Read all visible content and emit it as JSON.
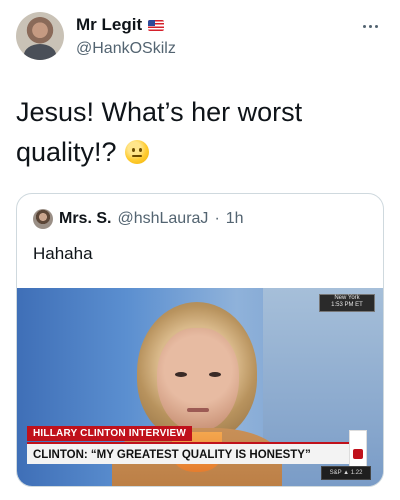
{
  "author": {
    "display_name": "Mr Legit",
    "handle": "@HankOSkilz",
    "flag_icon": "us-flag-icon"
  },
  "tweet": {
    "text": "Jesus! What’s her worst quality!?",
    "emoji_icon": "neutral-face-emoji-icon"
  },
  "quoted_tweet": {
    "display_name": "Mrs. S.",
    "handle": "@hshLauraJ",
    "separator": "·",
    "time": "1h",
    "text": "Hahaha",
    "media": {
      "location": "New York",
      "clock": "1:53 PM ET",
      "banner_title": "HILLARY CLINTON INTERVIEW",
      "banner_text": "CLINTON: “MY GREATEST QUALITY IS HONESTY”",
      "ticker": "S&P ▲ 1.22"
    }
  }
}
